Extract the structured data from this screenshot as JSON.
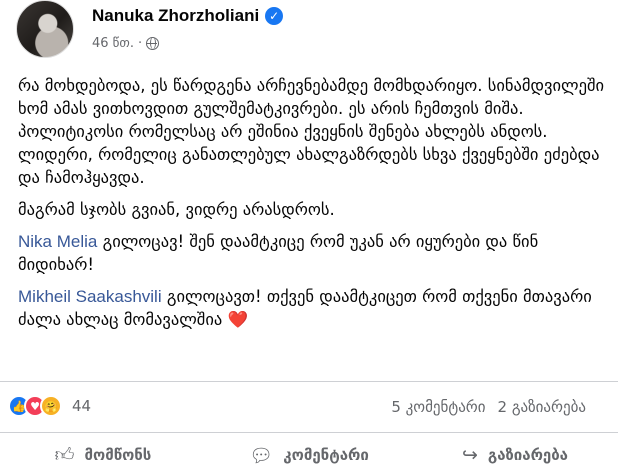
{
  "post": {
    "author": "Nanuka Zhorzholiani",
    "timestamp": "46 წთ.",
    "separator": "·",
    "visibility_icon": "globe-icon",
    "paragraph_1": "რა მოხდებოდა, ეს წარდგენა არჩევნებამდე მომხდარიყო. სინამდვილეში ხომ ამას ვითხოვდით გულშემატკივრები. ეს არის ჩემთვის მიშა. პოლიტიკოსი რომელსაც არ ეშინია ქვეყნის შენება ახლებს ანდოს. ლიდერი, რომელიც განათლებულ ახალგაზრდებს სხვა ქვეყნებში ეძებდა და ჩამოჰყავდა.",
    "paragraph_2": "მაგრამ სჯობს გვიან, ვიდრე არასდროს.",
    "mention_1_name": "Nika Melia",
    "mention_1_text": " გილოცავ! შენ დაამტკიცე რომ უკან არ იყურები და წინ მიდიხარ!",
    "mention_2_name": "Mikheil Saakashvili",
    "mention_2_text": " გილოცავთ! თქვენ დაამტკიცეთ რომ თქვენი მთავარი ძალა ახლაც მომავალშია ",
    "heart_emoji": "❤️"
  },
  "engagement": {
    "reaction_icons": [
      "like-icon",
      "love-icon",
      "care-icon"
    ],
    "reaction_count": "44",
    "comments": "5 კომენტარი",
    "shares": "2 გაზიარება"
  },
  "actions": {
    "like": "მომწონს",
    "comment": "კომენტარი",
    "share": "გაზიარება"
  },
  "colors": {
    "link": "#385898",
    "verified": "#1877f2",
    "secondary_text": "#65676b"
  }
}
